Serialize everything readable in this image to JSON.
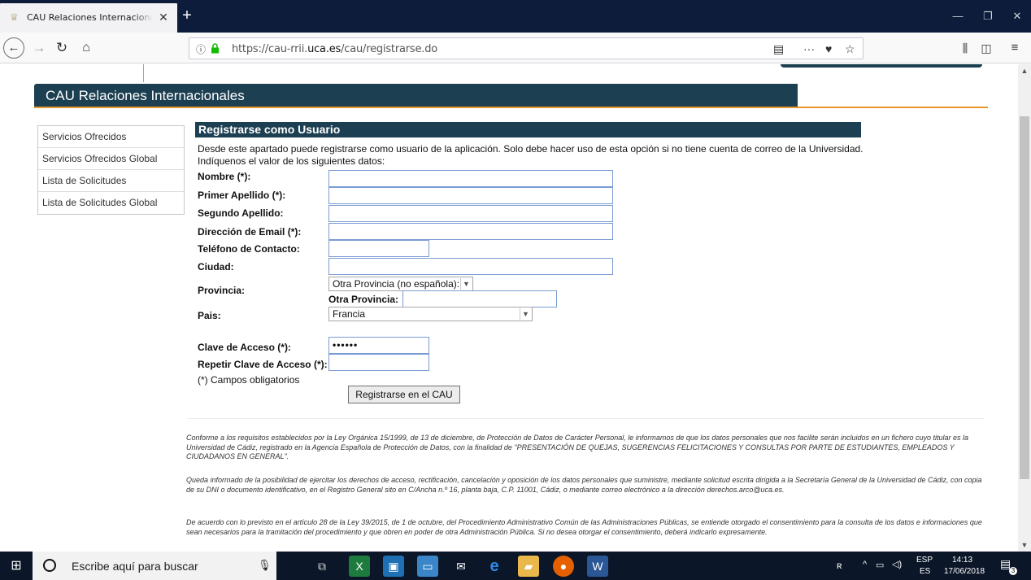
{
  "browser": {
    "tab_title": "CAU Relaciones Internacionales",
    "tab_close": "✕",
    "new_tab": "+",
    "url_prefix": "https://cau-rrii.",
    "url_domain": "uca.es",
    "url_path": "/cau/registrarse.do",
    "page_actions": "···"
  },
  "site": {
    "title": "CAU Relaciones Internacionales"
  },
  "sidebar": {
    "items": [
      {
        "label": "Servicios Ofrecidos"
      },
      {
        "label": "Servicios Ofrecidos Global"
      },
      {
        "label": "Lista de Solicitudes"
      },
      {
        "label": "Lista de Solicitudes Global"
      }
    ]
  },
  "form": {
    "title": "Registrarse como Usuario",
    "intro1": "Desde este apartado puede registrarse como usuario de la aplicación. Solo debe hacer uso de esta opción si no tiene cuenta de correo de la Universidad.",
    "intro2": "Indíquenos el valor de los siguientes datos:",
    "fields": {
      "nombre": {
        "label": "Nombre (*):",
        "value": ""
      },
      "apellido1": {
        "label": "Primer Apellido (*):",
        "value": ""
      },
      "apellido2": {
        "label": "Segundo Apellido:",
        "value": ""
      },
      "email": {
        "label": "Dirección de Email (*):",
        "value": ""
      },
      "telefono": {
        "label": "Teléfono de Contacto:",
        "value": ""
      },
      "ciudad": {
        "label": "Ciudad:",
        "value": ""
      },
      "provincia": {
        "label": "Provincia:",
        "selected": "Otra Provincia (no española):"
      },
      "otra_provincia": {
        "label": "Otra Provincia:",
        "value": ""
      },
      "pais": {
        "label": "Pais:",
        "selected": "Francia"
      },
      "clave": {
        "label": "Clave de Acceso (*):",
        "value": "••••••"
      },
      "repetir_clave": {
        "label": "Repetir Clave de Acceso (*):",
        "value": ""
      }
    },
    "required_note": "(*) Campos obligatorios",
    "submit_label": "Registrarse en el CAU"
  },
  "legal": {
    "p1": "Conforme a los requisitos establecidos por la Ley Orgánica 15/1999, de 13 de diciembre, de Protección de Datos de Carácter Personal, le informamos de que los datos personales que nos facilite serán incluidos en un fichero cuyo titular es la Universidad de Cádiz, registrado en la Agencia Española de Protección de Datos, con la finalidad de \"PRESENTACIÓN DE QUEJAS, SUGERENCIAS FELICITACIONES Y CONSULTAS POR PARTE DE ESTUDIANTES, EMPLEADOS Y CIUDADANOS EN GENERAL\".",
    "p2": "Queda informado de la posibilidad de ejercitar los derechos de acceso, rectificación, cancelación y oposición de los datos personales que suministre, mediante solicitud escrita dirigida a la Secretaría General de la Universidad de Cádiz, con copia de su DNI o documento identificativo, en el Registro General sito en C/Ancha n.º 16, planta baja, C.P. 11001, Cádiz, o mediante correo electrónico a la dirección derechos.arco@uca.es.",
    "p3": "De acuerdo con lo previsto en el artículo 28 de la Ley 39/2015, de 1 de octubre, del Procedimiento Administrativo Común de las Administraciones Públicas, se entiende otorgado el consentimiento para la consulta de los datos e informaciones que sean necesarios para la tramitación del procedimiento y que obren en poder de otra Administración Pública. Si no desea otorgar el consentimiento, deberá indicarlo expresamente."
  },
  "taskbar": {
    "search_placeholder": "Escribe aquí para buscar",
    "lang1": "ESP",
    "lang2": "ES",
    "time": "14:13",
    "date": "17/06/2018",
    "notif_count": "3"
  },
  "colors": {
    "header_bg": "#1c3f52",
    "accent_orange": "#e8962e",
    "input_border": "#7a9bd3"
  }
}
